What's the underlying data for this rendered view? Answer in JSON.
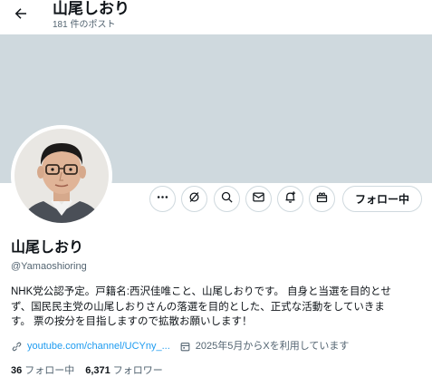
{
  "header": {
    "back_icon": "arrow-left-icon",
    "title": "山尾しおり",
    "post_count": "181 件のポスト"
  },
  "colors": {
    "banner": "#cfd9de",
    "link": "#1d9bf0",
    "secondary_text": "#536471",
    "primary_text": "#0f1419"
  },
  "actions": {
    "icons": [
      "more-icon",
      "grok-icon",
      "search-icon",
      "message-icon",
      "notification-bell-plus-icon",
      "subscribe-gift-icon"
    ],
    "follow_label": "フォロー中"
  },
  "profile": {
    "display_name": "山尾しおり",
    "handle": "@Yamaoshioring",
    "bio_lines": [
      "NHK党公認予定。戸籍名:西沢佳唯こと、山尾しおりです。 自身と当選を目的とせ",
      "ず、国民民主党の山尾しおりさんの落選を目的とした、正式な活動をしていきま",
      "す。 票の按分を目指しますので拡散お願いします！"
    ],
    "link_icon": "link-icon",
    "link_text": "youtube.com/channel/UCYny_...",
    "join_icon": "calendar-icon",
    "join_text": "2025年5月からXを利用しています"
  },
  "stats": {
    "following_count": "36",
    "following_label": "フォロー中",
    "followers_count": "6,371",
    "followers_label": "フォロワー"
  }
}
